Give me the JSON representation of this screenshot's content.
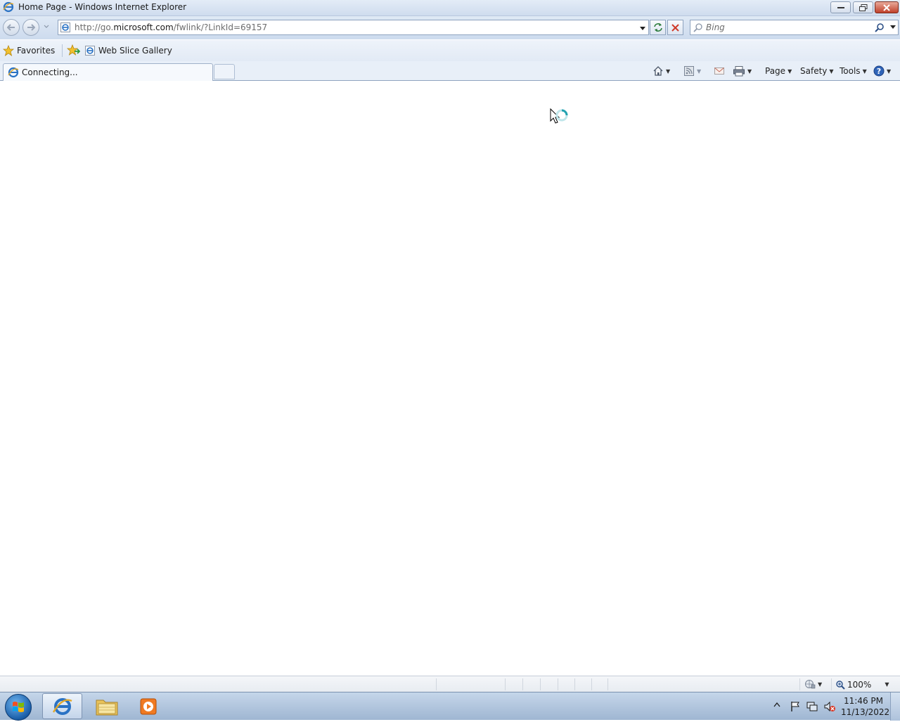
{
  "window": {
    "title": "Home Page - Windows Internet Explorer"
  },
  "navigation": {
    "address_prefix": "http://go.",
    "address_domain": "microsoft.com",
    "address_suffix": "/fwlink/?LinkId=69157",
    "search_placeholder": "Bing"
  },
  "favorites_bar": {
    "favorites_label": "Favorites",
    "web_slice_label": "Web Slice Gallery"
  },
  "tabs": [
    {
      "label": "Connecting..."
    }
  ],
  "command_bar": {
    "page_label": "Page",
    "safety_label": "Safety",
    "tools_label": "Tools"
  },
  "status_bar": {
    "zoom": "100%"
  },
  "taskbar": {
    "time": "11:46 PM",
    "date": "11/13/2022"
  },
  "colors": {
    "accent": "#1a5ea8",
    "close": "#c0412b"
  }
}
